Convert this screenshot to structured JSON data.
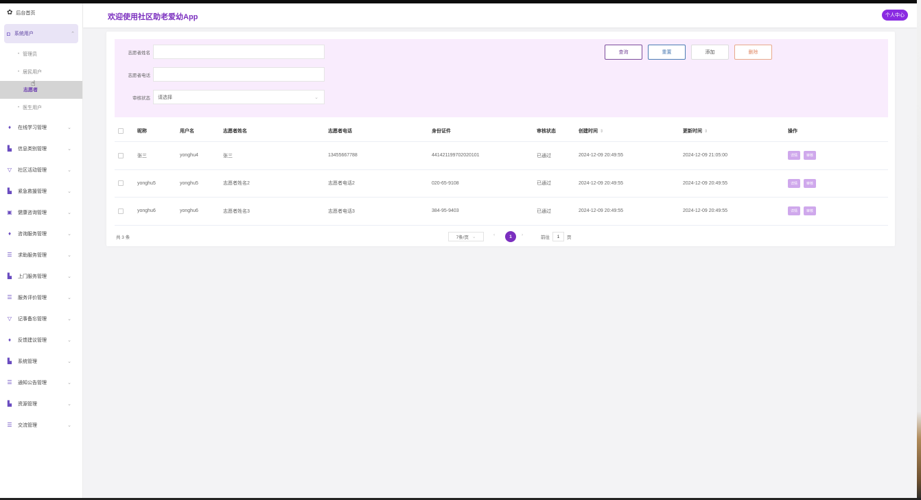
{
  "header": {
    "title": "欢迎使用社区助老爱幼App",
    "user_center": "个人中心"
  },
  "sidebar": {
    "home": "后台首页",
    "open_menu": "系统用户",
    "submenu": [
      "管理员",
      "居民用户",
      "志愿者",
      "医生用户"
    ],
    "active_sub": "志愿者",
    "items": [
      "在线学习管理",
      "信息类别管理",
      "社区活动管理",
      "紧急救援管理",
      "健康咨询管理",
      "咨询服务管理",
      "求助服务管理",
      "上门服务管理",
      "服务评价管理",
      "记事备忘管理",
      "反馈建议管理",
      "系统管理",
      "通知公告管理",
      "资源管理",
      "交流管理"
    ]
  },
  "search": {
    "name_label": "志愿者姓名",
    "name_value": "",
    "phone_label": "志愿者电话",
    "phone_value": "",
    "status_label": "审核状态",
    "status_placeholder": "请选择",
    "query": "查询",
    "reset": "重置",
    "add": "添加",
    "delete": "删除"
  },
  "table": {
    "columns": {
      "nickname": "昵称",
      "username": "用户名",
      "vname": "志愿者姓名",
      "vphone": "志愿者电话",
      "idcard": "身份证件",
      "status": "审核状态",
      "created": "创建时间",
      "updated": "更新时间",
      "ops": "操作"
    },
    "rows": [
      {
        "nickname": "张三",
        "username": "yonghu4",
        "vname": "张三",
        "vphone": "13455667788",
        "idcard": "441421199702020101",
        "status": "已通过",
        "created": "2024-12-09 20:49:55",
        "updated": "2024-12-09 21:05:00",
        "op1": "详情",
        "op2": "审核"
      },
      {
        "nickname": "yonghu5",
        "username": "yonghu5",
        "vname": "志愿者姓名2",
        "vphone": "志愿者电话2",
        "idcard": "020-65-9108",
        "status": "已通过",
        "created": "2024-12-09 20:49:55",
        "updated": "2024-12-09 20:49:55",
        "op1": "详情",
        "op2": "审核"
      },
      {
        "nickname": "yonghu6",
        "username": "yonghu6",
        "vname": "志愿者姓名3",
        "vphone": "志愿者电话3",
        "idcard": "384-95-9403",
        "status": "已通过",
        "created": "2024-12-09 20:49:55",
        "updated": "2024-12-09 20:49:55",
        "op1": "详情",
        "op2": "审核"
      }
    ]
  },
  "pager": {
    "total": "共 3 条",
    "page_size": "7条/页",
    "current": "1",
    "goto_prefix": "前往",
    "goto_value": "1",
    "goto_suffix": "页"
  },
  "colors": {
    "accent": "#7b2fbf",
    "op_button": "#cfa8ec",
    "search_bg": "#f9ecfd"
  }
}
